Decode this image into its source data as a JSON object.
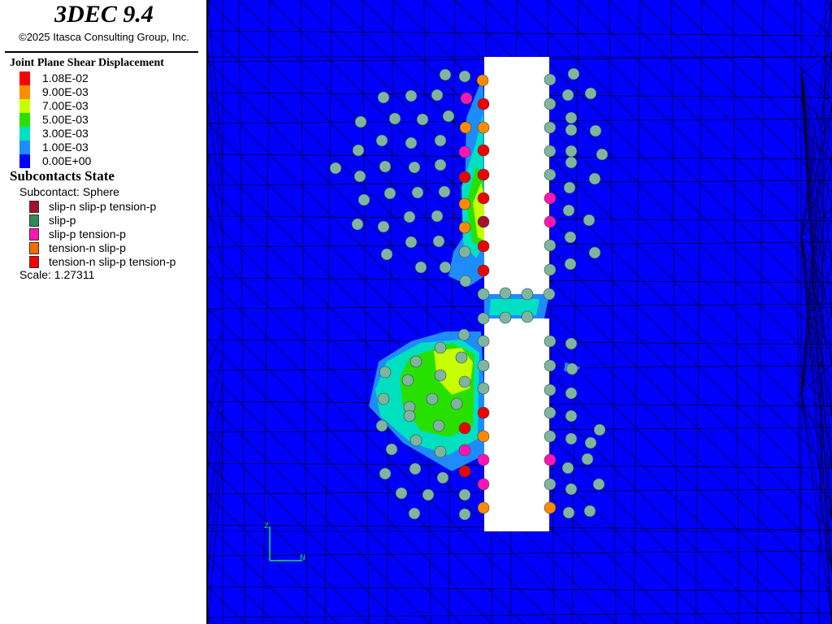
{
  "app": {
    "title": "3DEC 9.4",
    "copyright": "©2025 Itasca Consulting Group, Inc."
  },
  "legend": {
    "contour_title": "Joint Plane Shear Displacement",
    "contour_items": [
      {
        "label": "1.08E-02",
        "color": "#ff0000"
      },
      {
        "label": "9.00E-03",
        "color": "#ff8c00"
      },
      {
        "label": "7.00E-03",
        "color": "#c8ff00"
      },
      {
        "label": "5.00E-03",
        "color": "#28e000"
      },
      {
        "label": "3.00E-03",
        "color": "#00e0c0"
      },
      {
        "label": "1.00E-03",
        "color": "#1e8cff"
      },
      {
        "label": "0.00E+00",
        "color": "#0000ff"
      }
    ],
    "subcontacts_title": "Subcontacts State",
    "subcontact_type": "Subcontact: Sphere",
    "states": [
      {
        "label": "slip-n slip-p tension-p",
        "color": "#a50f2d"
      },
      {
        "label": "slip-p",
        "color": "#2e8b57"
      },
      {
        "label": "slip-p tension-p",
        "color": "#ff14b4"
      },
      {
        "label": "tension-n slip-p",
        "color": "#ff6a00"
      },
      {
        "label": "tension-n slip-p tension-p",
        "color": "#ff0000"
      }
    ],
    "scale": "Scale: 1.27311"
  },
  "axes": {
    "z_label": "Z",
    "n_label": "N"
  },
  "colors": {
    "background": "#0000ff",
    "mesh_line": "#000000",
    "excavation": "#ffffff",
    "sphere_slip": "#7fb5a0",
    "sphere_tension_slip": "#ff8a00",
    "sphere_tension_slip_tension": "#ee0000",
    "sphere_slip_tension": "#ff14b4",
    "axis": "#20e040"
  }
}
